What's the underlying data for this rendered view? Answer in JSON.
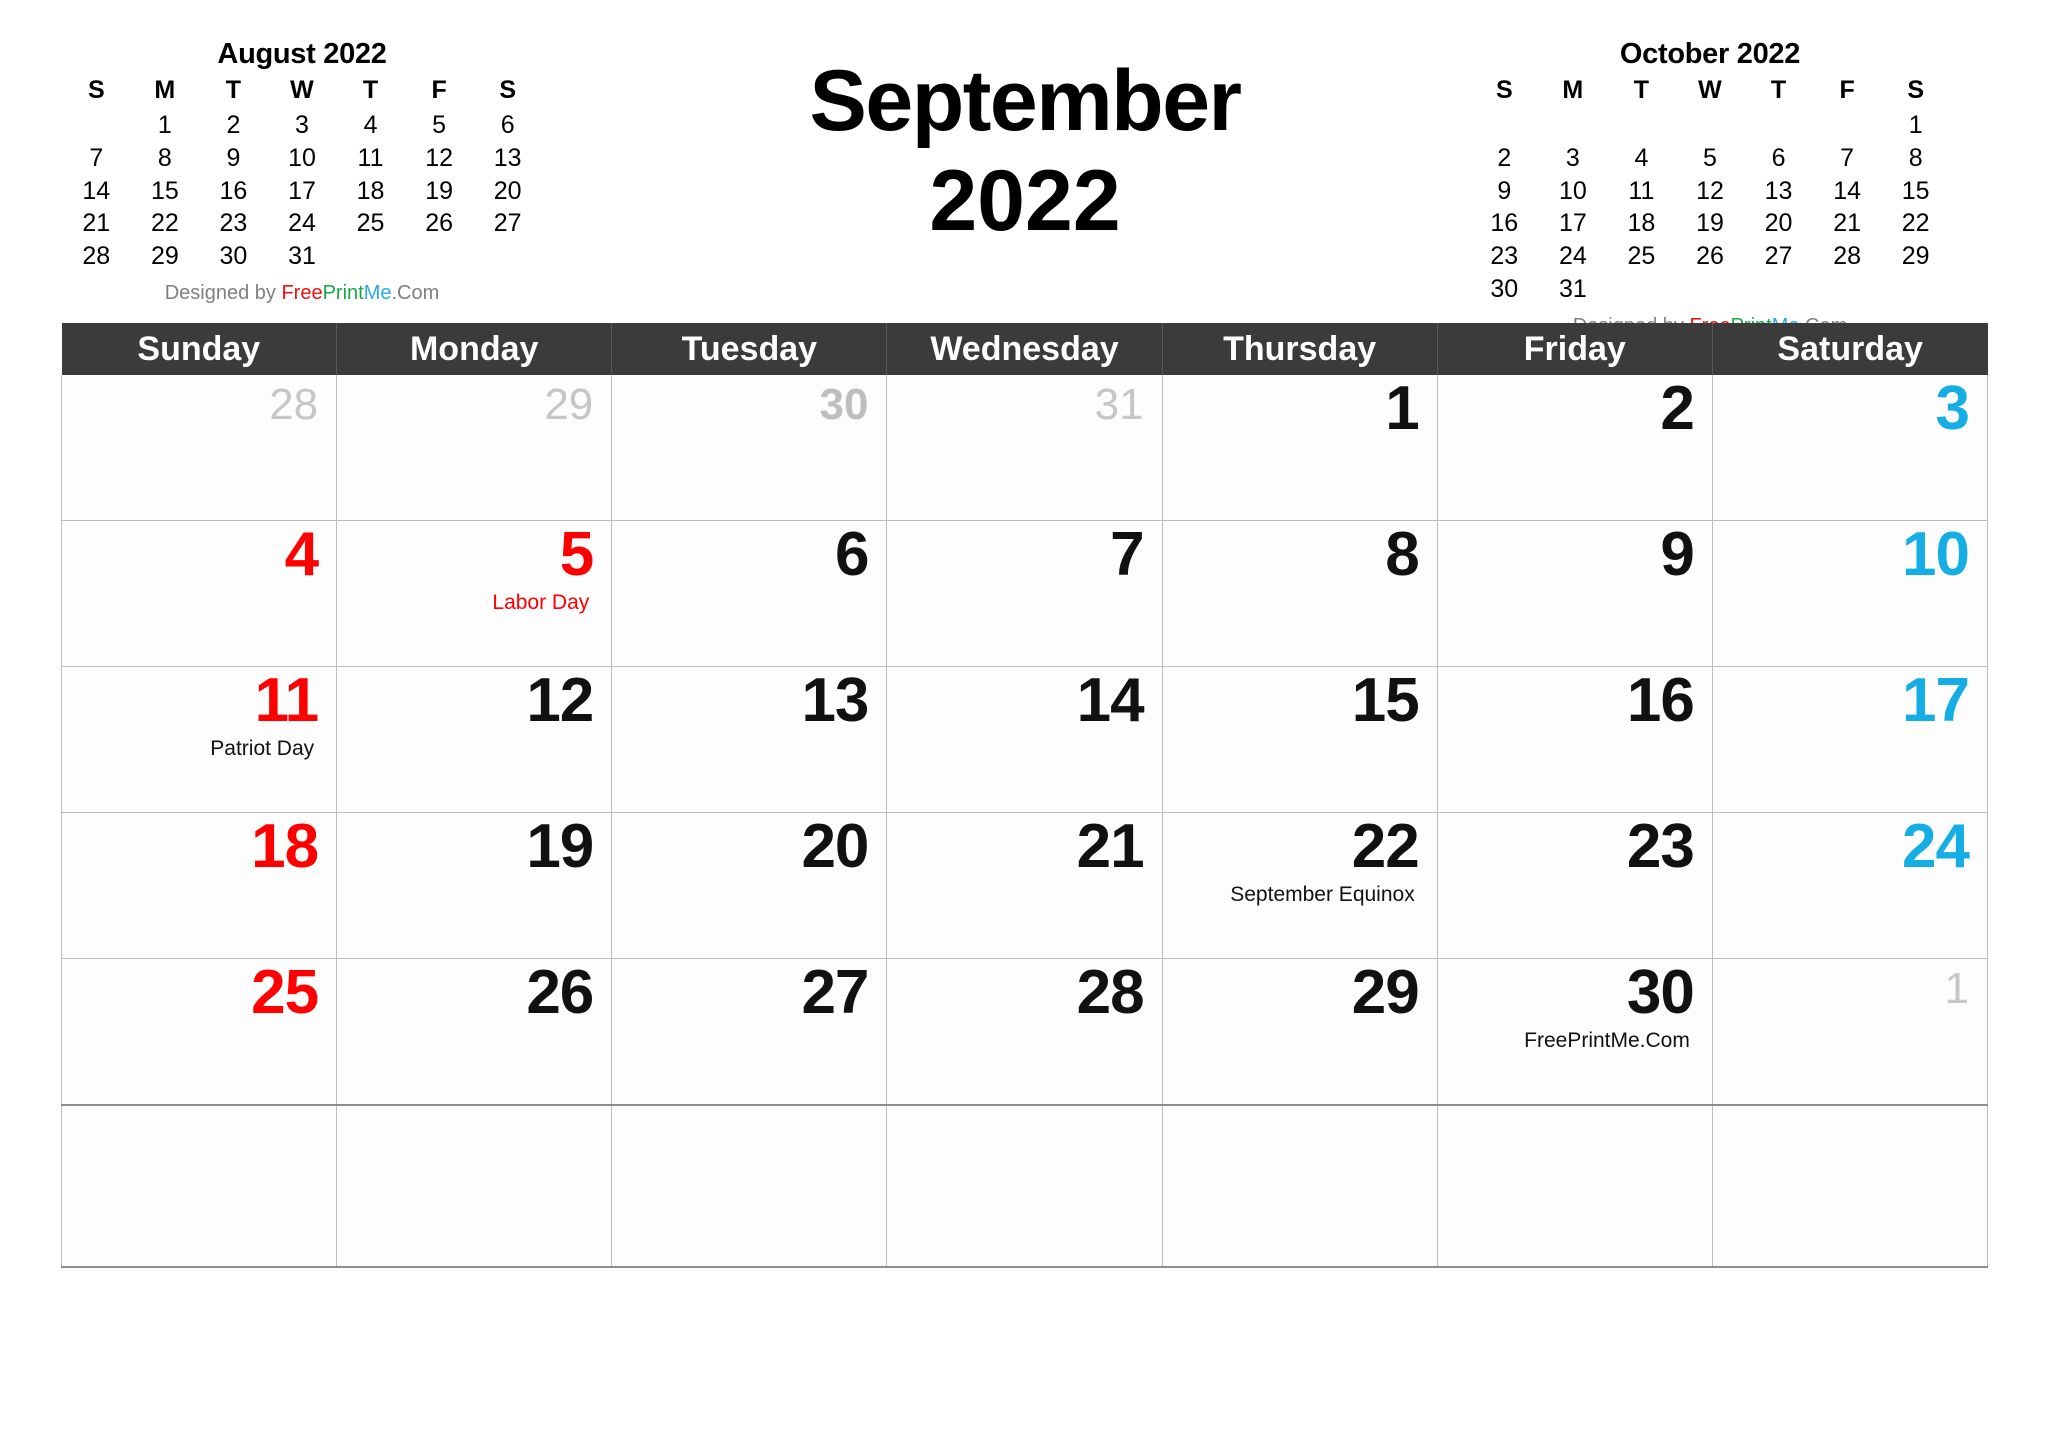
{
  "title": {
    "month": "September",
    "year": "2022"
  },
  "credit": {
    "prefix": "Designed by ",
    "free": "Free",
    "print": "Print",
    "me": "Me",
    "dotcom": ".Com",
    "colors": {
      "gray": "#808080",
      "red": "#ee1111",
      "green": "#17a84a",
      "blue": "#29abe2"
    }
  },
  "mini_prev": {
    "title": "August 2022",
    "weekdays": [
      "S",
      "M",
      "T",
      "W",
      "T",
      "F",
      "S"
    ],
    "weeks": [
      [
        "",
        "1",
        "2",
        "3",
        "4",
        "5",
        "6"
      ],
      [
        "7",
        "8",
        "9",
        "10",
        "11",
        "12",
        "13"
      ],
      [
        "14",
        "15",
        "16",
        "17",
        "18",
        "19",
        "20"
      ],
      [
        "21",
        "22",
        "23",
        "24",
        "25",
        "26",
        "27"
      ],
      [
        "28",
        "29",
        "30",
        "31",
        "",
        "",
        ""
      ]
    ]
  },
  "mini_next": {
    "title": "October 2022",
    "weekdays": [
      "S",
      "M",
      "T",
      "W",
      "T",
      "F",
      "S"
    ],
    "weeks": [
      [
        "",
        "",
        "",
        "",
        "",
        "",
        "1"
      ],
      [
        "2",
        "3",
        "4",
        "5",
        "6",
        "7",
        "8"
      ],
      [
        "9",
        "10",
        "11",
        "12",
        "13",
        "14",
        "15"
      ],
      [
        "16",
        "17",
        "18",
        "19",
        "20",
        "21",
        "22"
      ],
      [
        "23",
        "24",
        "25",
        "26",
        "27",
        "28",
        "29"
      ],
      [
        "30",
        "31",
        "",
        "",
        "",
        "",
        ""
      ]
    ]
  },
  "weekday_headers": [
    "Sunday",
    "Monday",
    "Tuesday",
    "Wednesday",
    "Thursday",
    "Friday",
    "Saturday"
  ],
  "colors": {
    "header_bg": "#3b3b3b",
    "header_text": "#ffffff",
    "sunday": "#fe0000",
    "saturday": "#14ade4",
    "weekday": "#111111",
    "muted": "#c6c6c6",
    "grid_line": "#bdbdbd"
  },
  "weeks": [
    [
      {
        "num": "28",
        "style": "muted",
        "event": ""
      },
      {
        "num": "29",
        "style": "muted",
        "event": ""
      },
      {
        "num": "30",
        "style": "muted-bold",
        "event": ""
      },
      {
        "num": "31",
        "style": "muted",
        "event": ""
      },
      {
        "num": "1",
        "style": "black",
        "event": ""
      },
      {
        "num": "2",
        "style": "black",
        "event": ""
      },
      {
        "num": "3",
        "style": "sat",
        "event": ""
      }
    ],
    [
      {
        "num": "4",
        "style": "sun",
        "event": ""
      },
      {
        "num": "5",
        "style": "red",
        "event": "Labor Day",
        "event_color": "red"
      },
      {
        "num": "6",
        "style": "black",
        "event": ""
      },
      {
        "num": "7",
        "style": "black",
        "event": ""
      },
      {
        "num": "8",
        "style": "black",
        "event": ""
      },
      {
        "num": "9",
        "style": "black",
        "event": ""
      },
      {
        "num": "10",
        "style": "sat",
        "event": ""
      }
    ],
    [
      {
        "num": "11",
        "style": "sun",
        "event": "Patriot Day",
        "event_color": "black"
      },
      {
        "num": "12",
        "style": "black",
        "event": ""
      },
      {
        "num": "13",
        "style": "black",
        "event": ""
      },
      {
        "num": "14",
        "style": "black",
        "event": ""
      },
      {
        "num": "15",
        "style": "black",
        "event": ""
      },
      {
        "num": "16",
        "style": "black",
        "event": ""
      },
      {
        "num": "17",
        "style": "sat",
        "event": ""
      }
    ],
    [
      {
        "num": "18",
        "style": "sun",
        "event": ""
      },
      {
        "num": "19",
        "style": "black",
        "event": ""
      },
      {
        "num": "20",
        "style": "black",
        "event": ""
      },
      {
        "num": "21",
        "style": "black",
        "event": ""
      },
      {
        "num": "22",
        "style": "black",
        "event": "September Equinox",
        "event_color": "black"
      },
      {
        "num": "23",
        "style": "black",
        "event": ""
      },
      {
        "num": "24",
        "style": "sat",
        "event": ""
      }
    ],
    [
      {
        "num": "25",
        "style": "sun",
        "event": ""
      },
      {
        "num": "26",
        "style": "black",
        "event": ""
      },
      {
        "num": "27",
        "style": "black",
        "event": ""
      },
      {
        "num": "28",
        "style": "black",
        "event": ""
      },
      {
        "num": "29",
        "style": "black",
        "event": ""
      },
      {
        "num": "30",
        "style": "black",
        "event": "FreePrintMe.Com",
        "event_color": "black"
      },
      {
        "num": "1",
        "style": "muted",
        "event": ""
      }
    ],
    [
      {
        "num": "",
        "style": "black",
        "event": ""
      },
      {
        "num": "",
        "style": "black",
        "event": ""
      },
      {
        "num": "",
        "style": "black",
        "event": ""
      },
      {
        "num": "",
        "style": "black",
        "event": ""
      },
      {
        "num": "",
        "style": "black",
        "event": ""
      },
      {
        "num": "",
        "style": "black",
        "event": ""
      },
      {
        "num": "",
        "style": "black",
        "event": ""
      }
    ]
  ]
}
